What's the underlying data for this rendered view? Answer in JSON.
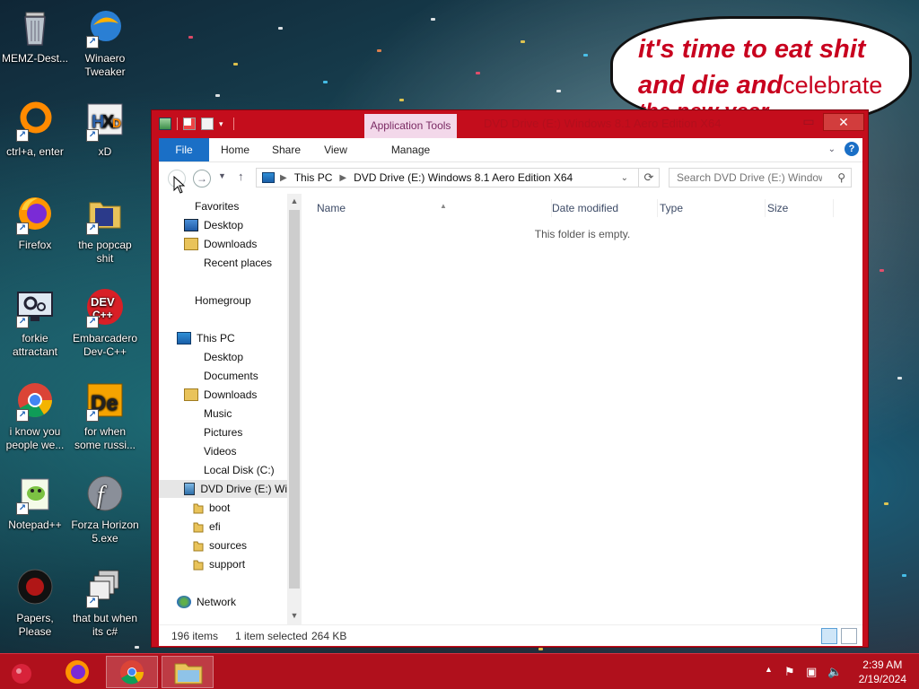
{
  "desktop": {
    "icons": [
      {
        "label": "MEMZ-Dest...",
        "icon": "recycle-bin-icon"
      },
      {
        "label": "Winaero Tweaker",
        "icon": "winaero-icon"
      },
      {
        "label": "ctrl+a, enter",
        "icon": "ring-icon"
      },
      {
        "label": "xD",
        "icon": "hxd-icon"
      },
      {
        "label": "Firefox",
        "icon": "firefox-icon"
      },
      {
        "label": "the popcap shit",
        "icon": "folder-icon"
      },
      {
        "label": "forkie attractant",
        "icon": "monitor-gear-icon"
      },
      {
        "label": "Embarcadero Dev-C++",
        "icon": "devcpp-icon"
      },
      {
        "label": "i know you people we...",
        "icon": "chrome-icon"
      },
      {
        "label": "for when some russi...",
        "icon": "de-icon"
      },
      {
        "label": "Notepad++",
        "icon": "notepadpp-icon"
      },
      {
        "label": "Forza Horizon 5.exe",
        "icon": "flash-icon"
      },
      {
        "label": "Papers, Please",
        "icon": "papers-please-icon"
      },
      {
        "label": "that but when its c#",
        "icon": "windows-stack-icon"
      }
    ],
    "bubble": {
      "line1": "it's time to eat shit",
      "line2": "and die and",
      "line2b": "celebrate",
      "line3": "the new year"
    }
  },
  "window": {
    "title": "DVD Drive (E:) Windows 8.1 Aero Edition X64",
    "context_tab": "Application Tools",
    "close_label": "✕",
    "tabs": [
      {
        "label": "File"
      },
      {
        "label": "Home"
      },
      {
        "label": "Share"
      },
      {
        "label": "View"
      },
      {
        "label": "Manage"
      }
    ],
    "address": {
      "crumb1": "This PC",
      "crumb2": "DVD Drive (E:) Windows 8.1 Aero Edition X64"
    },
    "search": {
      "placeholder": "Search DVD Drive (E:) Window..."
    },
    "nav": {
      "favorites": "Favorites",
      "fav_items": [
        "Desktop",
        "Downloads",
        "Recent places"
      ],
      "homegroup": "Homegroup",
      "this_pc": "This PC",
      "pc_items": [
        "Desktop",
        "Documents",
        "Downloads",
        "Music",
        "Pictures",
        "Videos",
        "Local Disk (C:)"
      ],
      "dvd": "DVD Drive (E:) Wi",
      "dvd_items": [
        "boot",
        "efi",
        "sources",
        "support"
      ],
      "network": "Network"
    },
    "columns": [
      "Name",
      "Date modified",
      "Type",
      "Size"
    ],
    "empty_text": "This folder is empty.",
    "status": {
      "items": "196 items",
      "selected": "1 item selected",
      "size": "264 KB"
    }
  },
  "taskbar": {
    "time": "2:39 AM",
    "date": "2/19/2024"
  },
  "colors": {
    "window_frame": "#c40d1c",
    "taskbar": "#b0101c",
    "file_tab": "#1a6fc6",
    "bubble_text": "#c8001e"
  }
}
